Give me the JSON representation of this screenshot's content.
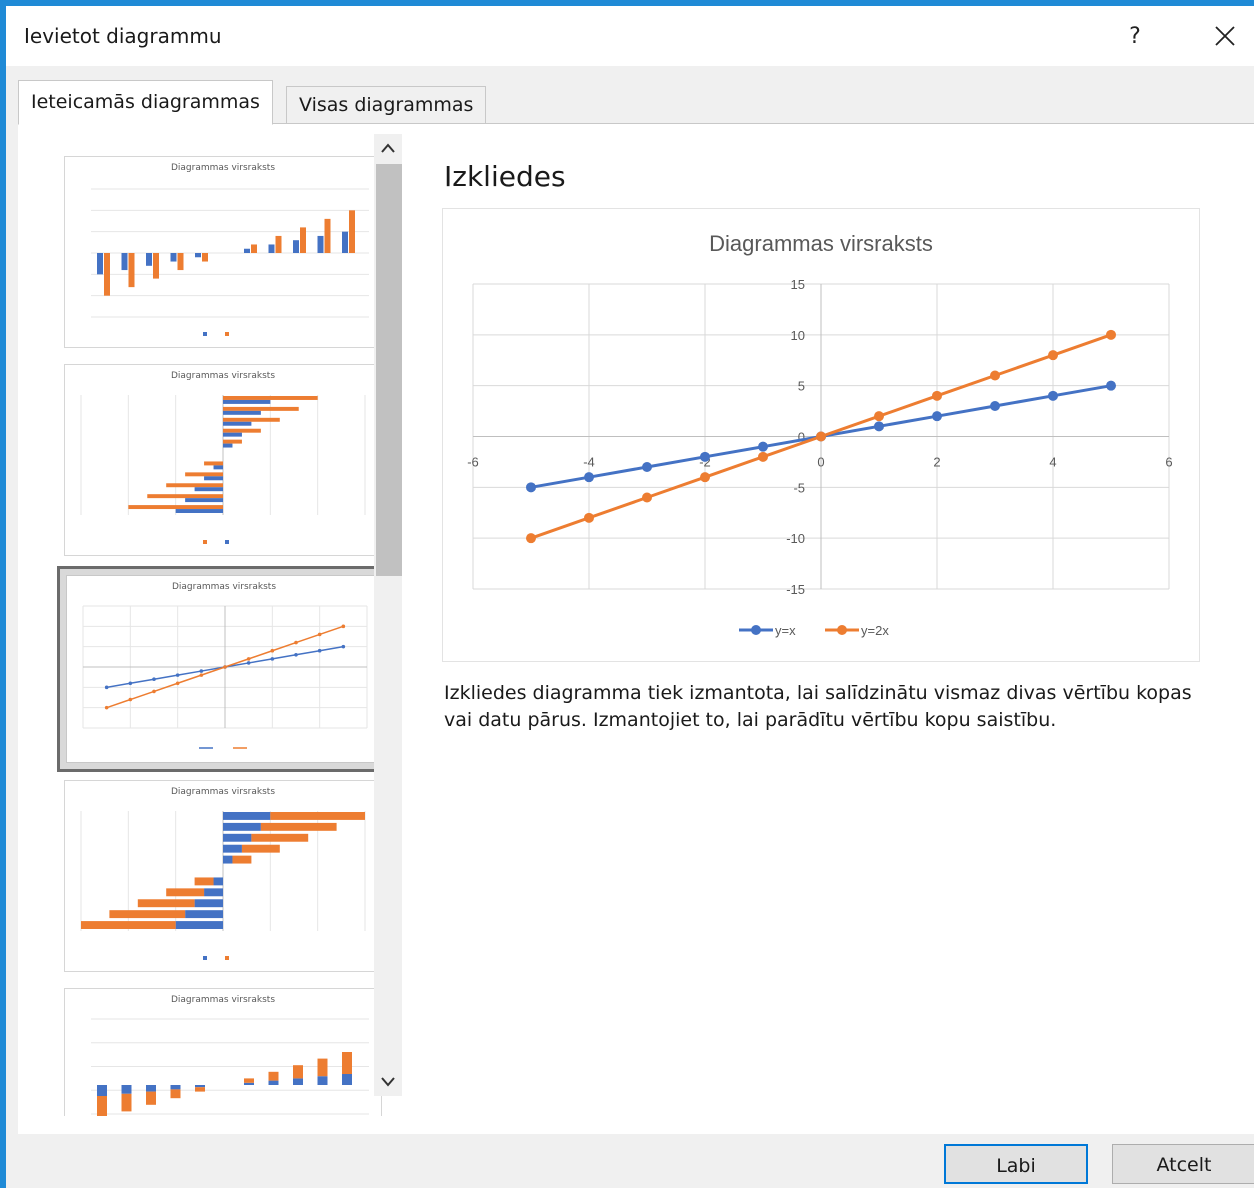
{
  "window": {
    "title": "Ievietot diagrammu",
    "help_label": "?"
  },
  "tabs": [
    {
      "label": "Ieteicamās diagrammas",
      "active": true
    },
    {
      "label": "Visas diagrammas",
      "active": false
    }
  ],
  "thumbnails": [
    {
      "title": "Diagrammas virsraksts",
      "kind": "clustered-column",
      "selected": false
    },
    {
      "title": "Diagrammas virsraksts",
      "kind": "clustered-bar",
      "selected": false
    },
    {
      "title": "Diagrammas virsraksts",
      "kind": "scatter",
      "selected": true
    },
    {
      "title": "Diagrammas virsraksts",
      "kind": "stacked-bar",
      "selected": false
    },
    {
      "title": "Diagrammas virsraksts",
      "kind": "stacked-column",
      "selected": false
    }
  ],
  "preview": {
    "heading": "Izkliedes"
  },
  "chart_data": {
    "type": "scatter",
    "title": "Diagrammas virsraksts",
    "xlabel": "",
    "ylabel": "",
    "xlim": [
      -6,
      6
    ],
    "ylim": [
      -15,
      15
    ],
    "xticks": [
      -6,
      -4,
      -2,
      0,
      2,
      4,
      6
    ],
    "yticks": [
      15,
      10,
      5,
      0,
      -5,
      -10,
      -15
    ],
    "grid": true,
    "legend": "bottom",
    "series": [
      {
        "name": "y=x",
        "color": "#4472c4",
        "x": [
          -5,
          -4,
          -3,
          -2,
          -1,
          0,
          1,
          2,
          3,
          4,
          5
        ],
        "y": [
          -5,
          -4,
          -3,
          -2,
          -1,
          0,
          1,
          2,
          3,
          4,
          5
        ]
      },
      {
        "name": "y=2x",
        "color": "#ed7d31",
        "x": [
          -5,
          -4,
          -3,
          -2,
          -1,
          0,
          1,
          2,
          3,
          4,
          5
        ],
        "y": [
          -10,
          -8,
          -6,
          -4,
          -2,
          0,
          2,
          4,
          6,
          8,
          10
        ]
      }
    ]
  },
  "description": "Izkliedes diagramma tiek izmantota, lai salīdzinātu vismaz divas vērtību kopas vai datu pārus. Izmantojiet to, lai parādītu vērtību kopu saistību.",
  "buttons": {
    "ok": "Labi",
    "cancel": "Atcelt"
  }
}
